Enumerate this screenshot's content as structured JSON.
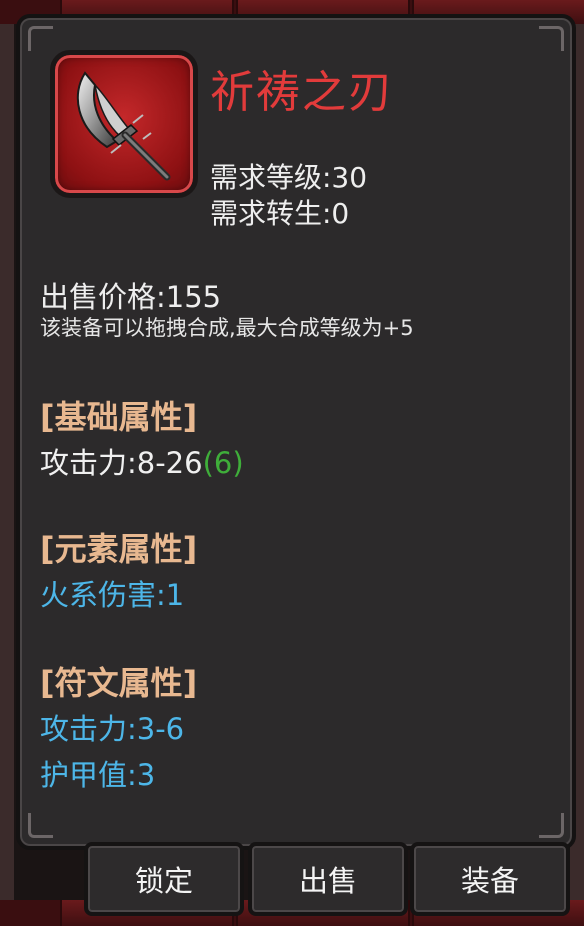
{
  "item": {
    "name": "祈祷之刃",
    "icon": "curved-blade-icon",
    "required_level": "需求等级:30",
    "required_rebirth": "需求转生:0",
    "sell_price": "出售价格:155",
    "note": "该装备可以拖拽合成,最大合成等级为+5"
  },
  "sections": {
    "basic": {
      "title": "[基础属性]",
      "attack_label": "攻击力:8-26",
      "attack_bonus": "(6)"
    },
    "element": {
      "title": "[元素属性]",
      "fire_damage": "火系伤害:1"
    },
    "rune": {
      "title": "[符文属性]",
      "attack": "攻击力:3-6",
      "armor": "护甲值:3"
    }
  },
  "buttons": {
    "lock": "锁定",
    "sell": "出售",
    "equip": "装备"
  },
  "colors": {
    "name": "#e23b3b",
    "section_title": "#e8b890",
    "rune_attr": "#4db6e8",
    "bonus": "#3fae3a"
  }
}
